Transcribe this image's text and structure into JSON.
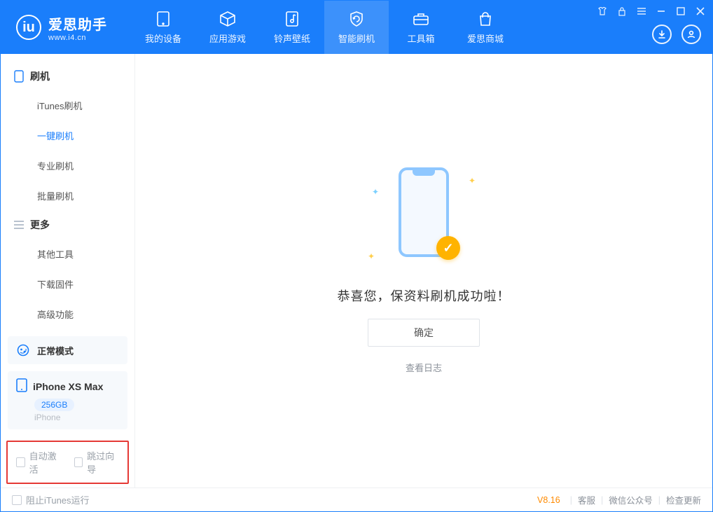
{
  "brand": {
    "name": "爱思助手",
    "site": "www.i4.cn"
  },
  "nav": [
    {
      "label": "我的设备"
    },
    {
      "label": "应用游戏"
    },
    {
      "label": "铃声壁纸"
    },
    {
      "label": "智能刷机"
    },
    {
      "label": "工具箱"
    },
    {
      "label": "爱思商城"
    }
  ],
  "sidebar": {
    "group1": {
      "title": "刷机",
      "items": [
        "iTunes刷机",
        "一键刷机",
        "专业刷机",
        "批量刷机"
      ]
    },
    "group2": {
      "title": "更多",
      "items": [
        "其他工具",
        "下载固件",
        "高级功能"
      ]
    }
  },
  "mode": {
    "label": "正常模式"
  },
  "device": {
    "name": "iPhone XS Max",
    "storage": "256GB",
    "type": "iPhone"
  },
  "options": {
    "auto_activate": "自动激活",
    "skip_guide": "跳过向导"
  },
  "main": {
    "success": "恭喜您，保资料刷机成功啦！",
    "ok": "确定",
    "view_log": "查看日志"
  },
  "status": {
    "block_itunes": "阻止iTunes运行",
    "version": "V8.16",
    "links": [
      "客服",
      "微信公众号",
      "检查更新"
    ]
  }
}
